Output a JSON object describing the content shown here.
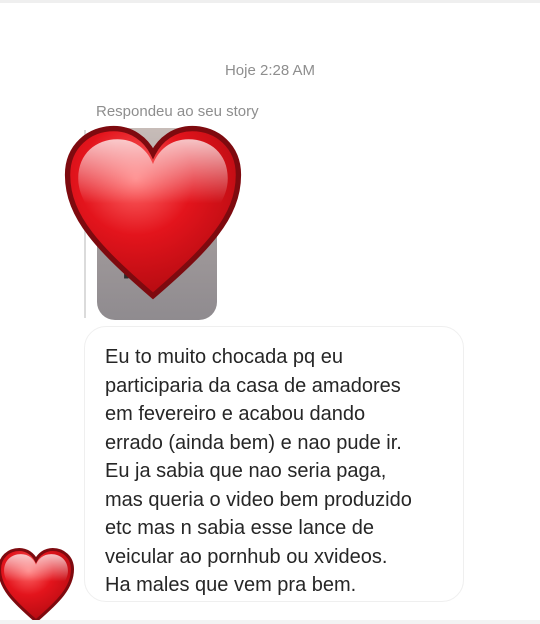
{
  "conversation": {
    "timestamp": "Hoje 2:28 AM",
    "replied_label": "Respondeu ao seu story",
    "message_text": "Eu to muito chocada pq eu\nparticiparia da casa de amadores\nem fevereiro e acabou dando\nerrado (ainda bem) e nao pude ir.\nEu ja sabia que nao seria paga,\nmas queria o video bem produzido\netc mas n sabia esse lance de\nveicular ao pornhub ou xvideos.\nHa males que vem pra bem."
  },
  "colors": {
    "heart_red": "#d9131b",
    "heart_outline": "#7e0a0f",
    "text_primary": "#262626",
    "text_muted": "#8e8e8e"
  },
  "icons": {
    "story_reaction": "red-heart-icon",
    "message_reaction": "red-heart-icon"
  }
}
